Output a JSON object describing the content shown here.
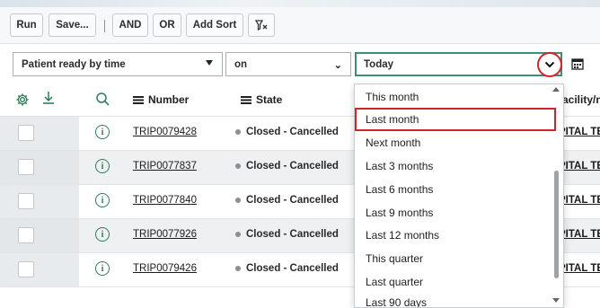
{
  "toolbar": {
    "run_label": "Run",
    "save_label": "Save...",
    "and_label": "AND",
    "or_label": "OR",
    "add_sort_label": "Add Sort",
    "clear_icon": "clear-filter-icon"
  },
  "filter": {
    "field": "Patient ready by time",
    "operator": "on",
    "value": "Today"
  },
  "columns": {
    "number": "Number",
    "state": "State",
    "facility": "facility/n"
  },
  "rows": [
    {
      "number": "TRIP0079428",
      "state": "Closed - Cancelled",
      "facility": "PITAL TES"
    },
    {
      "number": "TRIP0077837",
      "state": "Closed - Cancelled",
      "facility": "PITAL TES"
    },
    {
      "number": "TRIP0077840",
      "state": "Closed - Cancelled",
      "facility": "PITAL TES"
    },
    {
      "number": "TRIP0077926",
      "state": "Closed - Cancelled",
      "facility": "PITAL TES"
    },
    {
      "number": "TRIP0079426",
      "state": "Closed - Cancelled",
      "facility": "PITAL TES"
    }
  ],
  "dropdown": {
    "options": [
      "This month",
      "Last month",
      "Next month",
      "Last 3 months",
      "Last 6 months",
      "Last 9 months",
      "Last 12 months",
      "This quarter",
      "Last quarter",
      "Last 90 days"
    ],
    "highlighted": "Last month"
  },
  "colors": {
    "highlight": "#d2232a",
    "accent": "#2e7d55"
  }
}
